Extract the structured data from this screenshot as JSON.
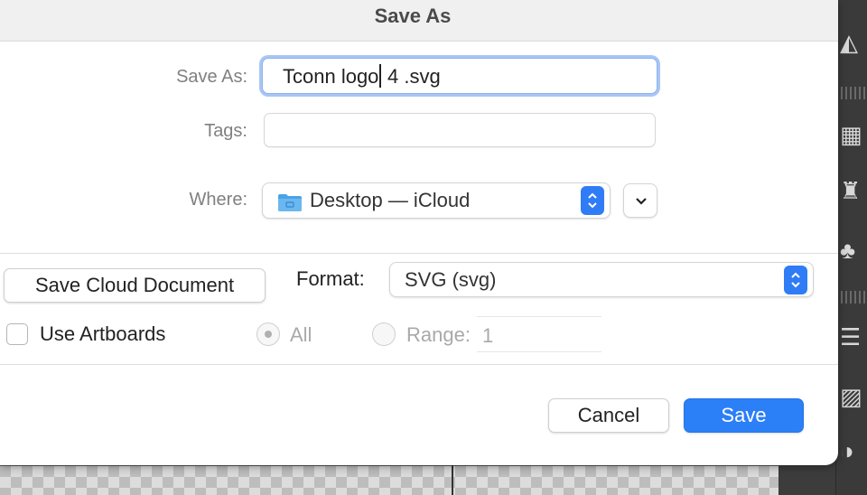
{
  "dialog": {
    "title": "Save As",
    "save_as": {
      "label": "Save As:",
      "value_before_caret": "Tconn logo",
      "value_after_caret": " 4 .svg"
    },
    "tags": {
      "label": "Tags:",
      "value": ""
    },
    "where": {
      "label": "Where:",
      "value": "Desktop — iCloud"
    },
    "save_cloud_button": "Save Cloud Document",
    "format": {
      "label": "Format:",
      "value": "SVG (svg)"
    },
    "use_artboards": {
      "label": "Use Artboards",
      "checked": false
    },
    "all_radio": {
      "label": "All",
      "selected": true,
      "enabled": false
    },
    "range_radio": {
      "label": "Range:",
      "selected": false,
      "enabled": false,
      "value": "1"
    },
    "cancel_button": "Cancel",
    "save_button": "Save"
  },
  "colors": {
    "accent": "#2b7ff7",
    "focus_ring": "#a8c6f5"
  },
  "icons": [
    "folder-icon",
    "chevron-up-down-icon",
    "chevron-down-icon"
  ]
}
